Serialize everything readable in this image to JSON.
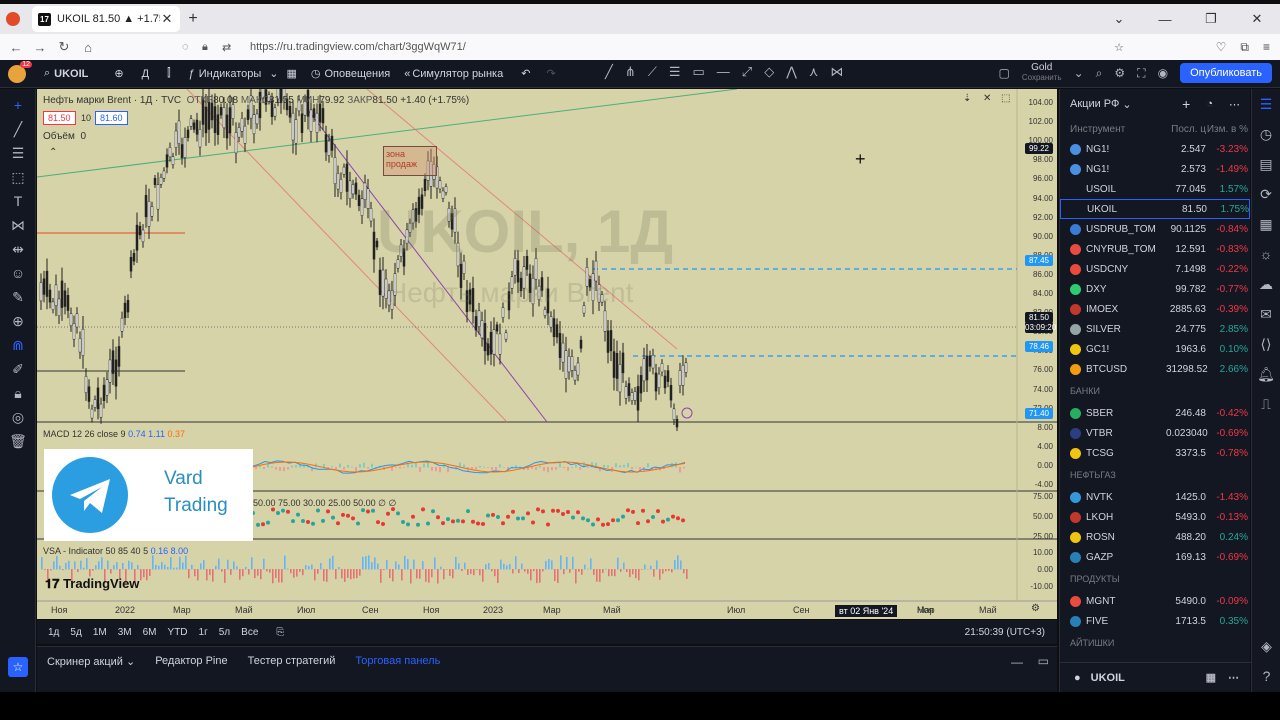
{
  "browser": {
    "tab_title": "UKOIL 81.50 ▲ +1.75% Gold",
    "url": "https://ru.tradingview.com/chart/3ggWqW71/"
  },
  "toolbar": {
    "avatar_badge": "12",
    "symbol": "UKOIL",
    "interval": "Д",
    "indicators_label": "Индикаторы",
    "alerts_label": "Оповещения",
    "replay_label": "Симулятор рынка",
    "layout_name": "Gold",
    "layout_status": "Сохранить",
    "publish_label": "Опубликовать"
  },
  "legend": {
    "title": "Нефть марки Brent · 1Д · TVC",
    "open_label": "ОТКР",
    "open": "80.08",
    "high_label": "МАКС",
    "high": "81.55",
    "low_label": "МИН",
    "low": "79.92",
    "close_label": "ЗАКР",
    "close": "81.50",
    "change": "+1.40 (+1.75%)",
    "bid": "81.50",
    "spread": "10",
    "ask": "81.60",
    "volume_label": "Объём",
    "volume": "0"
  },
  "watermark": {
    "main": "UKOIL, 1Д",
    "sub": "Нефть марки Brent"
  },
  "zone_label": "зона продаж",
  "panels": {
    "macd_label": "MACD 12 26 close 9",
    "macd_v1": "0.74",
    "macd_v2": "1.11",
    "macd_v3": "0.37",
    "rsi_label": "50.00 75.00 30.00 25.00 50.00 ∅ ∅",
    "vsa_label": "VSA - Indicator 50 85 40 5",
    "vsa_v1": "0.16",
    "vsa_v2": "8.00"
  },
  "telegram": {
    "line1": "Vard",
    "line2": "Trading"
  },
  "tv_logo": "TradingView",
  "price_scale": {
    "ticks": [
      "104.00",
      "102.00",
      "100.00",
      "98.00",
      "96.00",
      "94.00",
      "92.00",
      "90.00",
      "88.00",
      "86.00",
      "84.00",
      "82.00",
      "80.00",
      "78.00",
      "76.00",
      "74.00",
      "72.00"
    ],
    "label_top": "99.22",
    "label_high": "87.45",
    "label_current": "81.50",
    "label_countdown": "03:09:20",
    "label_low": "78.46",
    "label_bottom": "71.40",
    "macd_ticks": [
      "8.00",
      "4.00",
      "0.00",
      "-4.00"
    ],
    "rsi_ticks": [
      "75.00",
      "50.00",
      "25.00"
    ],
    "vsa_ticks": [
      "10.00",
      "0.00",
      "-10.00"
    ]
  },
  "time_scale": {
    "labels": [
      "Ноя",
      "2022",
      "Мар",
      "Май",
      "Июл",
      "Сен",
      "Ноя",
      "2023",
      "Мар",
      "Май",
      "Июл",
      "Сен",
      "Ноя",
      "Мар",
      "Май"
    ],
    "crosshair": "вт 02 Янв '24"
  },
  "range_bar": {
    "ranges": [
      "1д",
      "5д",
      "1М",
      "3М",
      "6М",
      "YTD",
      "1г",
      "5л",
      "Все"
    ],
    "clock": "21:50:39 (UTC+3)"
  },
  "bottom_tabs": [
    "Скринер акций",
    "Редактор Pine",
    "Тестер стратегий",
    "Торговая панель"
  ],
  "watchlist": {
    "title": "Акции РФ",
    "col_instrument": "Инструмент",
    "col_price": "Посл. ц",
    "col_change": "Изм. в %",
    "groups": [
      {
        "name": "",
        "rows": [
          {
            "symbol": "NG1!",
            "price": "2.547",
            "change": "-3.23%",
            "dir": "down",
            "color": "#4a90e2"
          },
          {
            "symbol": "NG1!",
            "price": "2.573",
            "change": "-1.49%",
            "dir": "down",
            "color": "#4a90e2"
          },
          {
            "symbol": "USOIL",
            "price": "77.045",
            "change": "1.57%",
            "dir": "up",
            "color": "#131722"
          },
          {
            "symbol": "UKOIL",
            "price": "81.50",
            "change": "1.75%",
            "dir": "up",
            "color": "#131722"
          },
          {
            "symbol": "USDRUB_TOM",
            "price": "90.1125",
            "change": "-0.84%",
            "dir": "down",
            "color": "#3a7bd5"
          },
          {
            "symbol": "CNYRUB_TOM",
            "price": "12.591",
            "change": "-0.83%",
            "dir": "down",
            "color": "#e74c3c"
          },
          {
            "symbol": "USDCNY",
            "price": "7.1498",
            "change": "-0.22%",
            "dir": "down",
            "color": "#e74c3c"
          },
          {
            "symbol": "DXY",
            "price": "99.782",
            "change": "-0.77%",
            "dir": "down",
            "color": "#2ecc71"
          },
          {
            "symbol": "IMOEX",
            "price": "2885.63",
            "change": "-0.39%",
            "dir": "down",
            "color": "#c0392b"
          },
          {
            "symbol": "SILVER",
            "price": "24.775",
            "change": "2.85%",
            "dir": "up",
            "color": "#95a5a6"
          },
          {
            "symbol": "GC1!",
            "price": "1963.6",
            "change": "0.10%",
            "dir": "up",
            "color": "#f1c40f"
          },
          {
            "symbol": "BTCUSD",
            "price": "31298.52",
            "change": "2.66%",
            "dir": "up",
            "color": "#f39c12"
          }
        ]
      },
      {
        "name": "БАНКИ",
        "rows": [
          {
            "symbol": "SBER",
            "price": "246.48",
            "change": "-0.42%",
            "dir": "down",
            "color": "#27ae60"
          },
          {
            "symbol": "VTBR",
            "price": "0.023040",
            "change": "-0.69%",
            "dir": "down",
            "color": "#2c3e80"
          },
          {
            "symbol": "TCSG",
            "price": "3373.5",
            "change": "-0.78%",
            "dir": "down",
            "color": "#f1c40f"
          }
        ]
      },
      {
        "name": "НЕФТЬГАЗ",
        "rows": [
          {
            "symbol": "NVTK",
            "price": "1425.0",
            "change": "-1.43%",
            "dir": "down",
            "color": "#3498db"
          },
          {
            "symbol": "LKOH",
            "price": "5493.0",
            "change": "-0.13%",
            "dir": "down",
            "color": "#c0392b"
          },
          {
            "symbol": "ROSN",
            "price": "488.20",
            "change": "0.24%",
            "dir": "up",
            "color": "#f1c40f"
          },
          {
            "symbol": "GAZP",
            "price": "169.13",
            "change": "-0.69%",
            "dir": "down",
            "color": "#2980b9"
          }
        ]
      },
      {
        "name": "ПРОДУКТЫ",
        "rows": [
          {
            "symbol": "MGNT",
            "price": "5490.0",
            "change": "-0.09%",
            "dir": "down",
            "color": "#e74c3c"
          },
          {
            "symbol": "FIVE",
            "price": "1713.5",
            "change": "0.35%",
            "dir": "up",
            "color": "#2980b9"
          }
        ]
      },
      {
        "name": "АЙТИШКИ",
        "rows": []
      }
    ],
    "footer_symbol": "UKOIL"
  },
  "colors": {
    "up": "#26a69a",
    "down": "#f23645",
    "accent": "#2962ff",
    "chart_bg": "#d6d3a8"
  }
}
